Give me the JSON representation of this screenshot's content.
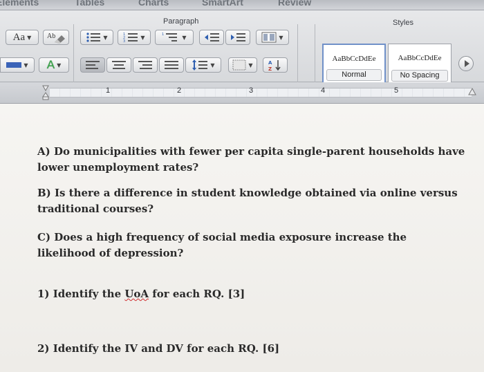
{
  "ribbon": {
    "tabs": [
      "Elements",
      "Tables",
      "Charts",
      "SmartArt",
      "Review"
    ],
    "paragraph_group_title": "Paragraph",
    "styles_group_title": "Styles",
    "font_size_button": "Aa",
    "font_color_button": "A",
    "styles": [
      {
        "sample": "AaBbCcDdEe",
        "name": "Normal"
      },
      {
        "sample": "AaBbCcDdEe",
        "name": "No Spacing"
      }
    ]
  },
  "ruler": {
    "numbers": [
      "1",
      "2",
      "3",
      "4",
      "5"
    ]
  },
  "document": {
    "questions": [
      "A) Do municipalities with fewer per capita single-parent households have lower unemployment rates?",
      "B) Is there a difference in student knowledge obtained via online versus traditional courses?",
      "C) Does a high frequency of social media exposure increase the likelihood of depression?"
    ],
    "task1_prefix": "1) Identify the ",
    "task1_uoa": "UoA",
    "task1_suffix": " for each RQ. [3]",
    "task2": "2) Identify the IV and DV for each RQ. [6]"
  },
  "colors": {
    "spellcheck_underline": "#d03030",
    "selected_style_border": "#6f90c8",
    "highlight_bar_blue": "#3a63b8",
    "font_color_green": "#3aa34a"
  }
}
